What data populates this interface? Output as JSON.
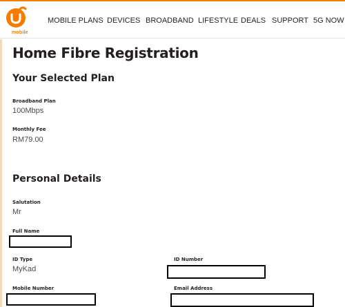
{
  "brand": {
    "logo_text": "mobile",
    "accent": "#f57c00"
  },
  "nav": {
    "items": [
      "MOBILE PLANS",
      "DEVICES",
      "BROADBAND",
      "LIFESTYLE",
      "DEALS",
      "SUPPORT",
      "5G NOW"
    ]
  },
  "page": {
    "title": "Home Fibre Registration",
    "selected_plan_heading": "Your Selected Plan",
    "personal_details_heading": "Personal Details"
  },
  "plan": {
    "broadband_label": "Broadband Plan",
    "broadband_value": "100Mbps",
    "fee_label": "Monthly Fee",
    "fee_value": "RM79.00"
  },
  "personal": {
    "salutation_label": "Salutation",
    "salutation_value": "Mr",
    "full_name_label": "Full Name",
    "full_name_value": "",
    "id_type_label": "ID Type",
    "id_type_value": "MyKad",
    "id_number_label": "ID Number",
    "id_number_value": "",
    "mobile_label": "Mobile Number",
    "mobile_value": "",
    "email_label": "Email Address",
    "email_value": ""
  }
}
